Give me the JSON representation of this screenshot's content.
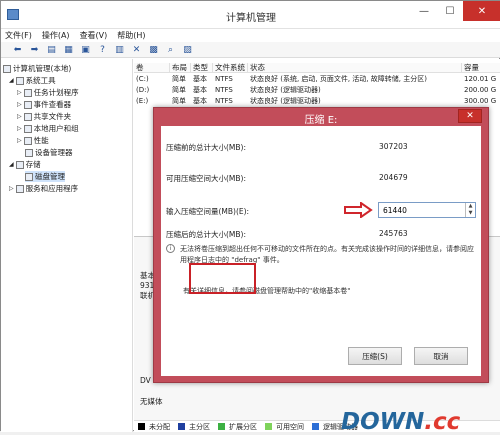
{
  "window": {
    "title": "计算机管理",
    "controls": [
      "—",
      "☐",
      "✕"
    ]
  },
  "menu": [
    "文件(F)",
    "操作(A)",
    "查看(V)",
    "帮助(H)"
  ],
  "toolbar_icons": [
    "back-arrow-icon",
    "forward-arrow-icon",
    "folder-up-icon",
    "tree-toggle-icon",
    "properties-icon",
    "help-icon",
    "refresh-icon",
    "delete-icon",
    "open-icon",
    "search-icon",
    "settings-icon"
  ],
  "tree": {
    "root": "计算机管理(本地)",
    "items": [
      {
        "label": "系统工具",
        "level": 1
      },
      {
        "label": "任务计划程序",
        "level": 2
      },
      {
        "label": "事件查看器",
        "level": 2
      },
      {
        "label": "共享文件夹",
        "level": 2
      },
      {
        "label": "本地用户和组",
        "level": 2
      },
      {
        "label": "性能",
        "level": 2
      },
      {
        "label": "设备管理器",
        "level": 2
      },
      {
        "label": "存储",
        "level": 1
      },
      {
        "label": "磁盘管理",
        "level": 2,
        "selected": true
      },
      {
        "label": "服务和应用程序",
        "level": 1
      }
    ]
  },
  "volumes": {
    "headers": [
      "卷",
      "布局",
      "类型",
      "文件系统",
      "状态",
      "容量"
    ],
    "rows": [
      [
        "(C:)",
        "简单",
        "基本",
        "NTFS",
        "状态良好 (系统, 启动, 页面文件, 活动, 故障转储, 主分区)",
        "120.01 G"
      ],
      [
        "(D:)",
        "简单",
        "基本",
        "NTFS",
        "状态良好 (逻辑驱动器)",
        "200.00 G"
      ],
      [
        "(E:)",
        "简单",
        "基本",
        "NTFS",
        "状态良好 (逻辑驱动器)",
        "300.00 G"
      ]
    ]
  },
  "lower_labels": [
    "基本",
    "931",
    "联机",
    "DV",
    "无媒体"
  ],
  "legend": [
    {
      "label": "未分配",
      "color": "#000000"
    },
    {
      "label": "主分区",
      "color": "#1f3f9f"
    },
    {
      "label": "扩展分区",
      "color": "#3cb043"
    },
    {
      "label": "可用空间",
      "color": "#7fd35b"
    },
    {
      "label": "逻辑驱动器",
      "color": "#2d6fd6"
    }
  ],
  "dialog": {
    "title": "压缩 E:",
    "fields": [
      {
        "label": "压缩前的总计大小(MB):",
        "value": "307203"
      },
      {
        "label": "可用压缩空间大小(MB):",
        "value": "204679"
      },
      {
        "label": "输入压缩空间量(MB)(E):",
        "value": "61440"
      },
      {
        "label": "压缩后的总计大小(MB):",
        "value": "245763"
      }
    ],
    "info": "无法将卷压缩到超出任何不可移动的文件所在的点。有关完成该操作时间的详细信息，请参阅应用程序日志中的 \"defrag\" 事件。",
    "help": "有关详细信息，请参阅磁盘管理帮助中的\"收缩基本卷\"",
    "ok": "压缩(S)",
    "cancel": "取消"
  },
  "watermark": {
    "main": "DOWN",
    "accent": ".cc"
  }
}
